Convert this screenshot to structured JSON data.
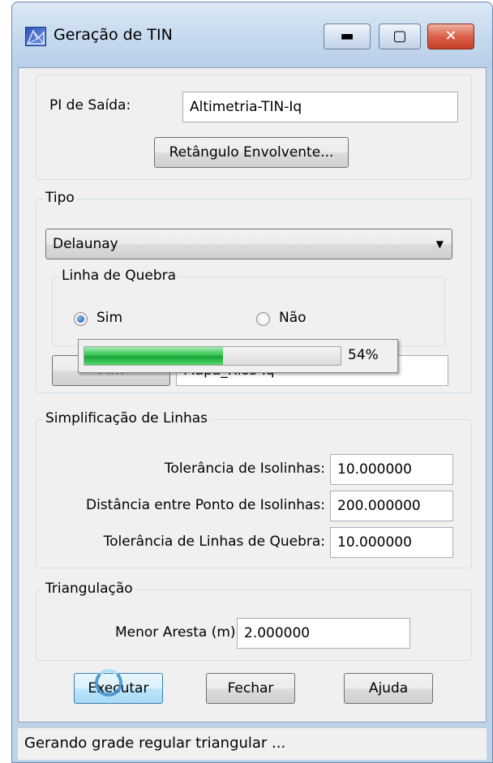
{
  "window": {
    "title": "Geração de TIN"
  },
  "output": {
    "label": "PI de Saída:",
    "value": "Altimetria-TIN-Iq",
    "bbox_button": "Retângulo Envolvente..."
  },
  "tipo": {
    "group_label": "Tipo",
    "selected": "Delaunay",
    "breakline": {
      "group_label": "Linha de Quebra",
      "yes_label": "Sim",
      "no_label": "Não",
      "selected": "Sim"
    },
    "partial_field": "Mapa_Rios-Iq",
    "partial_button": "Plm"
  },
  "progress": {
    "value": 0.54,
    "label": "54%"
  },
  "simplification": {
    "group_label": "Simplificação de Linhas",
    "rows": [
      {
        "label": "Tolerância de Isolinhas:",
        "value": "10.000000"
      },
      {
        "label": "Distância entre Ponto de Isolinhas:",
        "value": "200.000000"
      },
      {
        "label": "Tolerância de Linhas de Quebra:",
        "value": "10.000000"
      }
    ]
  },
  "triangulation": {
    "group_label": "Triangulação",
    "label": "Menor Aresta (m):",
    "value": "2.000000"
  },
  "buttons": {
    "execute": "Executar",
    "close": "Fechar",
    "help": "Ajuda"
  },
  "status": {
    "text": "Gerando grade regular triangular ..."
  },
  "icons": [
    "tin-app-icon",
    "minimize-icon",
    "maximize-icon",
    "close-icon",
    "dropdown-arrow-icon",
    "busy-spinner-icon"
  ],
  "colors": {
    "progress_fill": "#1aa437",
    "title_bar": "#c4d8ee",
    "close_button": "#d9604a"
  }
}
